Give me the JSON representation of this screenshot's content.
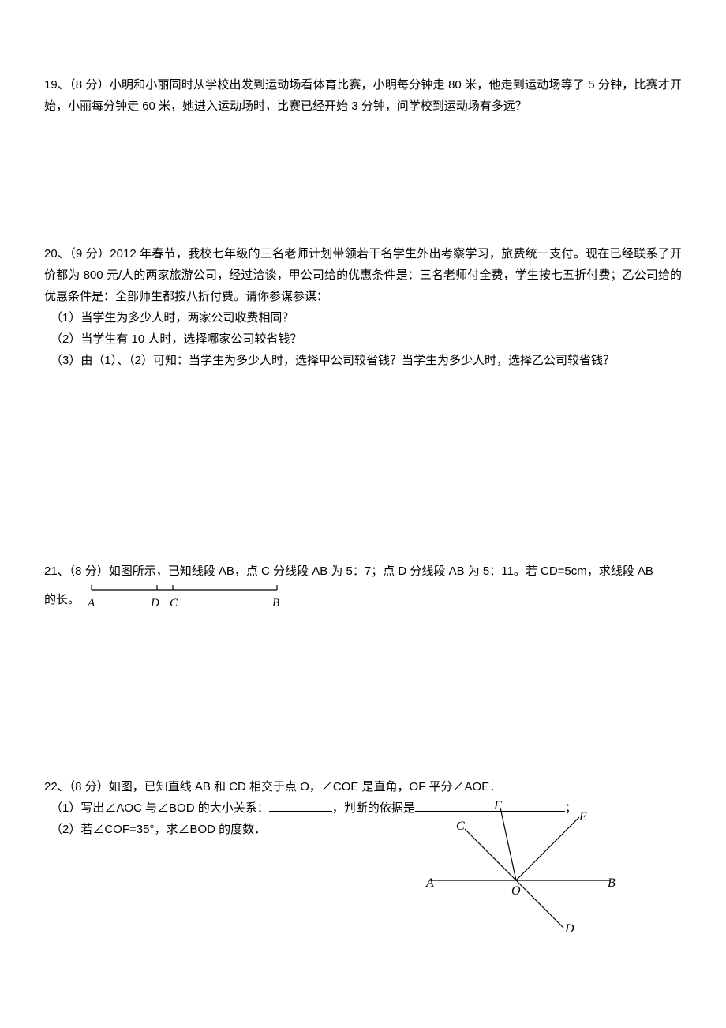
{
  "q19": {
    "text": "19、（8 分）小明和小丽同时从学校出发到运动场看体育比赛，小明每分钟走 80 米，他走到运动场等了 5 分钟，比赛才开始，小丽每分钟走 60 米，她进入运动场时，比赛已经开始 3 分钟，问学校到运动场有多远？"
  },
  "q20": {
    "intro": "20、（9 分）2012 年春节，我校七年级的三名老师计划带领若干名学生外出考察学习，旅费统一支付。现在已经联系了开价都为 800 元/人的两家旅游公司，经过洽谈，甲公司给的优惠条件是：三名老师付全费，学生按七五折付费；乙公司给的优惠条件是：全部师生都按八折付费。请你参谋参谋：",
    "p1": "（1）当学生为多少人时，两家公司收费相同？",
    "p2": "（2）当学生有 10 人时，选择哪家公司较省钱？",
    "p3": "（3）由（1）、（2）可知：当学生为多少人时，选择甲公司较省钱？当学生为多少人时，选择乙公司较省钱？"
  },
  "q21": {
    "pre": "21、（8 分）如图所示，已知线段 AB，点 C 分线段 AB 为 5：7；点 D 分线段 AB 为 5：11。若 CD=5cm，求线段 AB",
    "post": "的长。",
    "labels": {
      "A": "A",
      "D": "D",
      "C": "C",
      "B": "B"
    }
  },
  "q22": {
    "intro": "22、（8 分）如图，已知直线 AB 和 CD 相交于点 O，∠COE 是直角，OF 平分∠AOE．",
    "p1_a": "（1）写出∠AOC 与∠BOD 的大小关系：",
    "p1_b": "，判断的依据是",
    "p1_c": "；",
    "p2": "（2）若∠COF=35°，求∠BOD 的度数．",
    "labels": {
      "A": "A",
      "B": "B",
      "C": "C",
      "D": "D",
      "E": "E",
      "F": "F",
      "O": "O"
    }
  }
}
